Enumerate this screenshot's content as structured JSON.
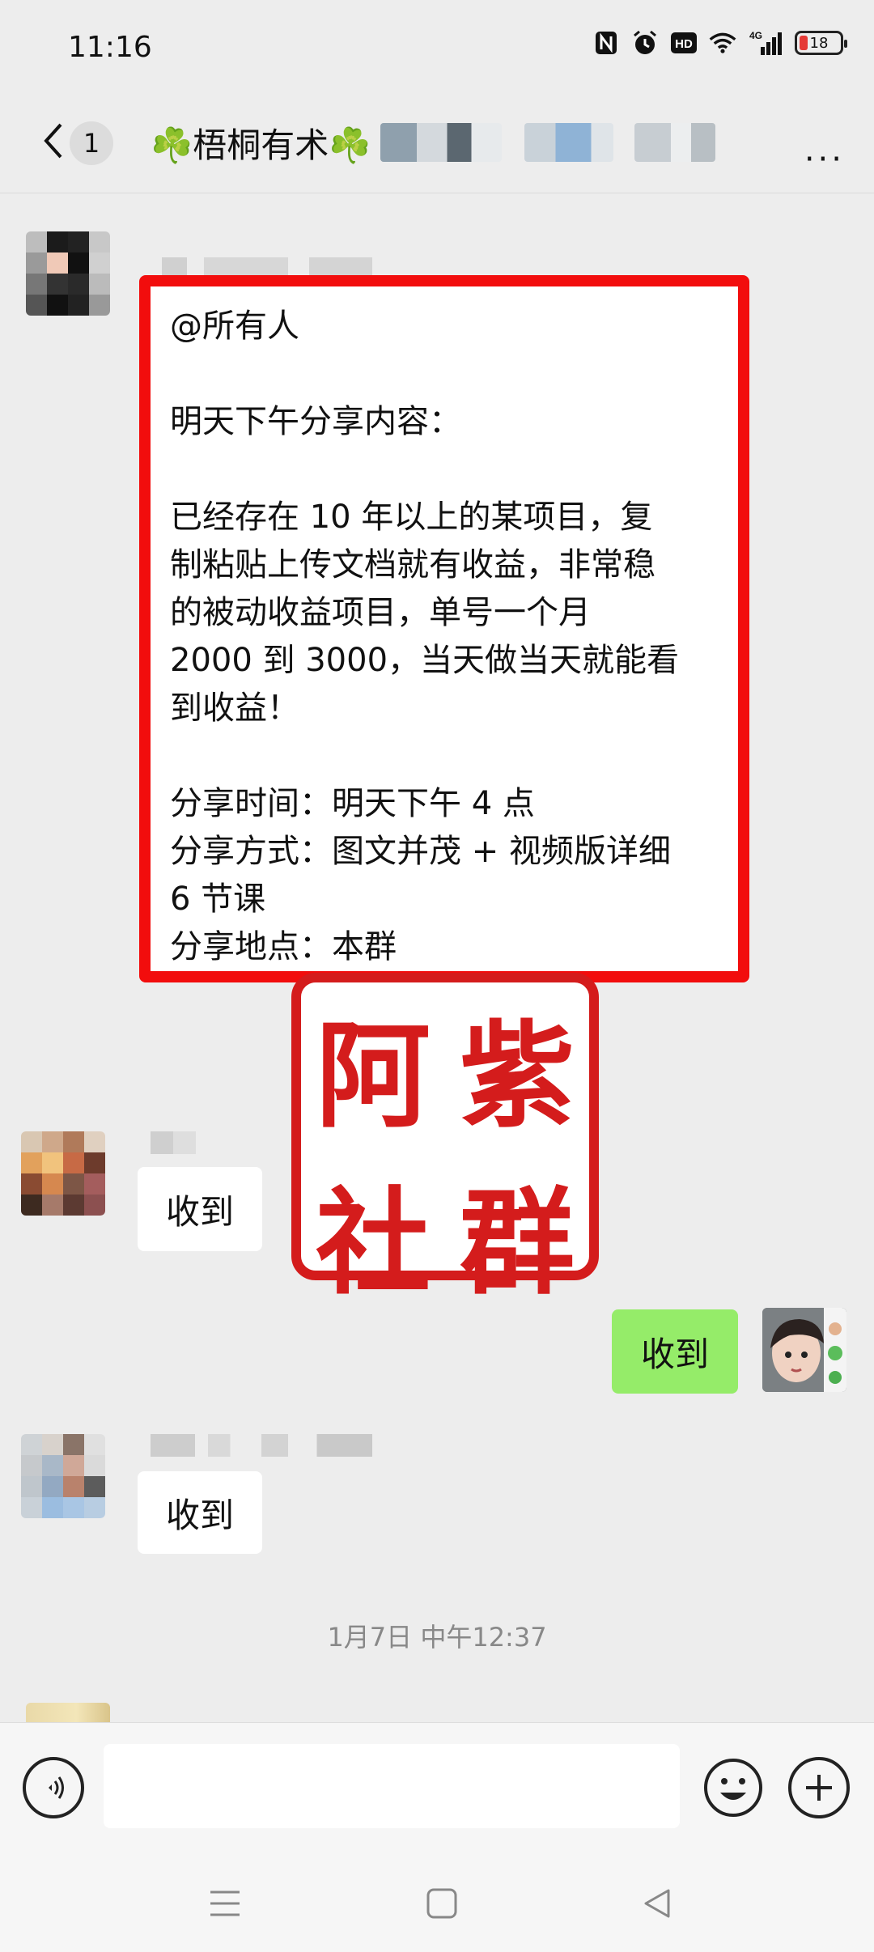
{
  "status_bar": {
    "time": "11:16",
    "battery": "18",
    "network": "4G"
  },
  "header": {
    "back_count": "1",
    "title": "☘️梧桐有术☘️",
    "more_label": "···"
  },
  "messages": {
    "announcement": {
      "lines": [
        "@所有人",
        "",
        "明天下午分享内容：",
        "",
        "已经存在 10 年以上的某项目，复",
        "制粘贴上传文档就有收益，非常稳",
        "的被动收益项目，单号一个月",
        "2000 到 3000，当天做当天就能看",
        "到收益！",
        "",
        "分享时间：明天下午 4 点",
        "分享方式：图文并茂 + 视频版详细",
        "6 节课",
        "分享地点：本群"
      ]
    },
    "reply_1": "收到",
    "reply_self": "收到",
    "reply_2": "收到"
  },
  "stamp": {
    "chars": [
      "阿",
      "紫",
      "社",
      "群"
    ]
  },
  "timestamp": "1月7日 中午12:37",
  "input": {
    "placeholder": ""
  }
}
